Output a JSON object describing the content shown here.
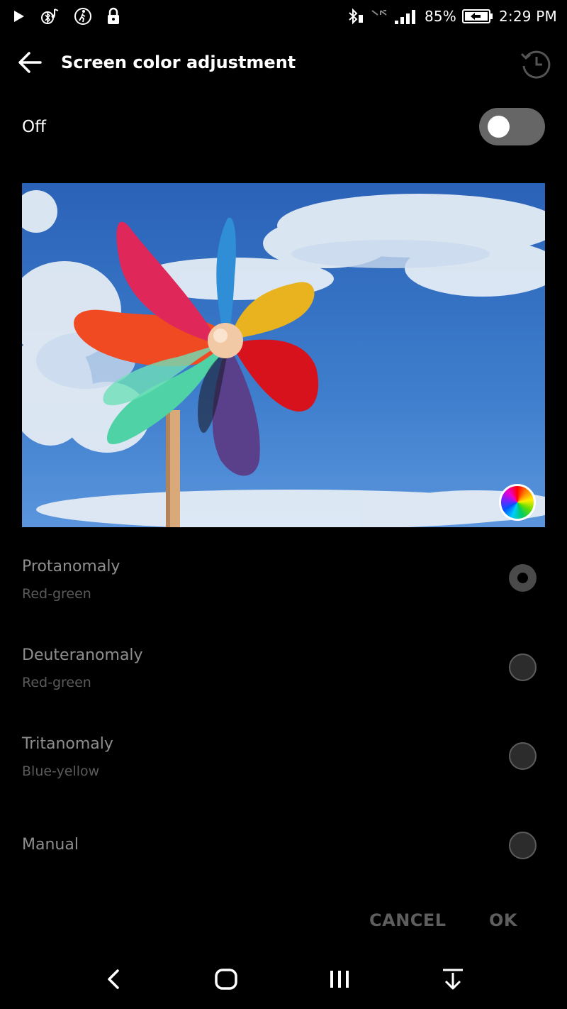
{
  "status_bar": {
    "battery_percent": "85%",
    "time": "2:29 PM",
    "icons_left": [
      "play-icon",
      "bluetooth-music-icon",
      "walking-icon",
      "lock-icon"
    ],
    "icons_right": [
      "bluetooth-icon",
      "no-data-icon",
      "signal-icon",
      "battery-icon"
    ]
  },
  "app_bar": {
    "title": "Screen color adjustment",
    "back_icon": "arrow-left-icon",
    "history_icon": "history-icon"
  },
  "toggle": {
    "label": "Off",
    "state": "off"
  },
  "preview": {
    "color_wheel_icon": "color-wheel-icon"
  },
  "options": [
    {
      "label": "Protanomaly",
      "sub": "Red-green",
      "selected": true
    },
    {
      "label": "Deuteranomaly",
      "sub": "Red-green",
      "selected": false
    },
    {
      "label": "Tritanomaly",
      "sub": "Blue-yellow",
      "selected": false
    },
    {
      "label": "Manual",
      "sub": "",
      "selected": false
    }
  ],
  "buttons": {
    "cancel": "CANCEL",
    "ok": "OK"
  },
  "nav_bar": {
    "icons": [
      "back-nav-icon",
      "home-icon",
      "recents-icon",
      "hide-nav-icon"
    ]
  },
  "colors": {
    "background": "#000000",
    "disabled_text": "#8e8e8e",
    "toggle_track": "#666666"
  }
}
